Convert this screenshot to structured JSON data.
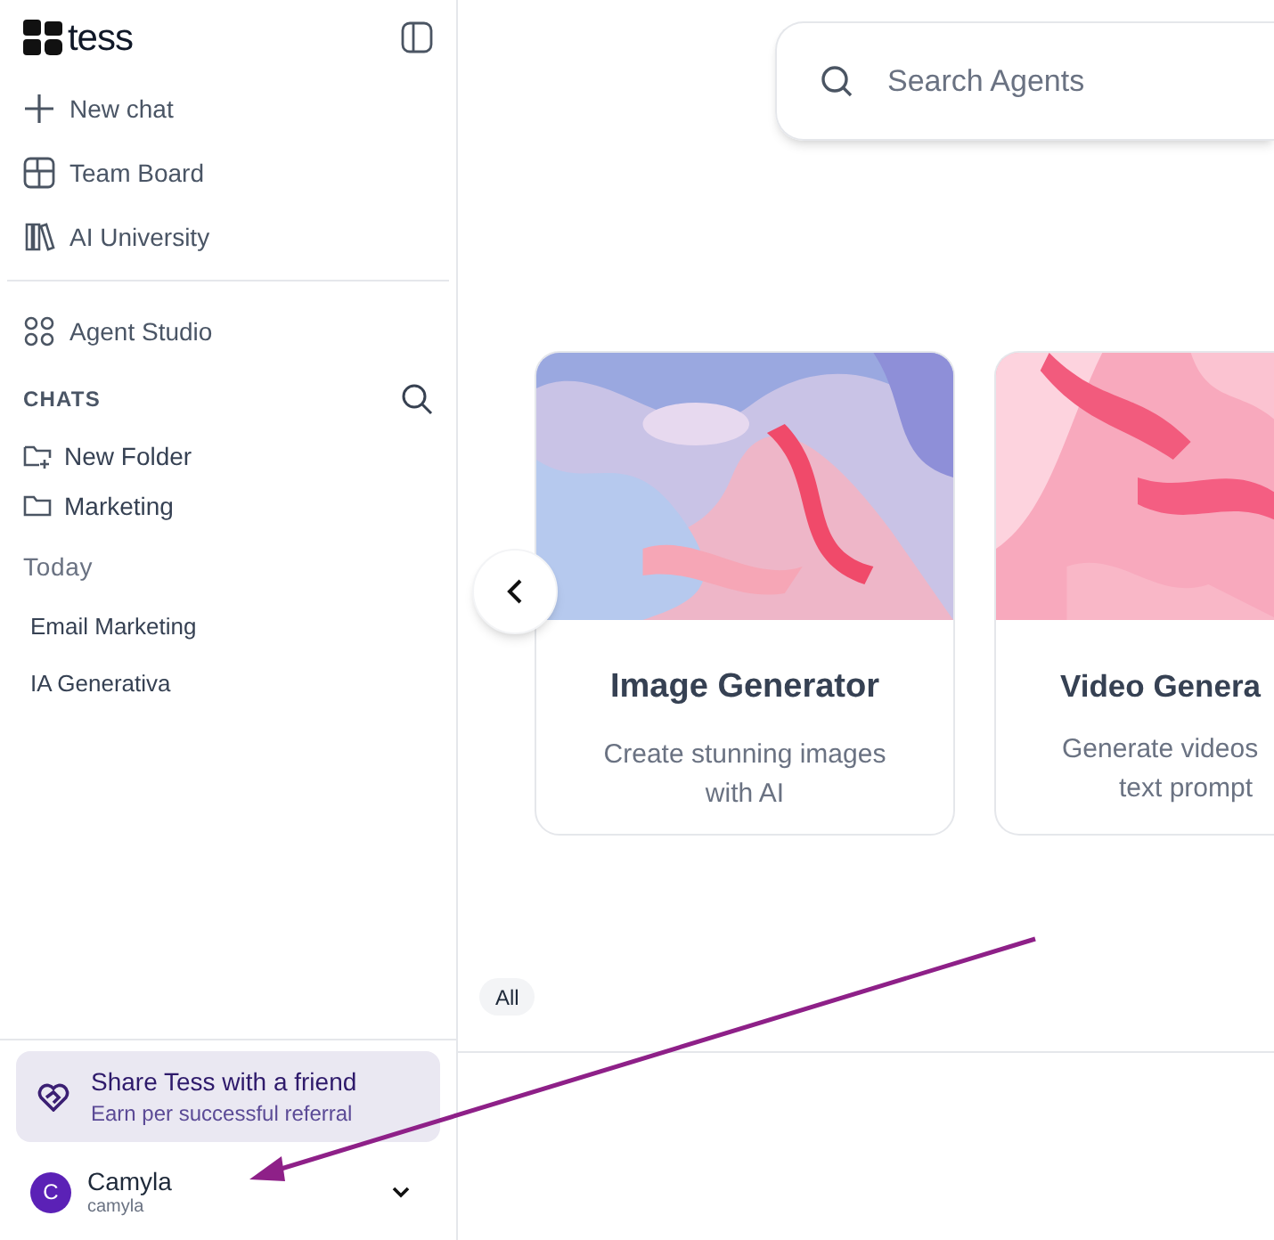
{
  "sidebar": {
    "logo": "tess",
    "nav": [
      {
        "kind": "plus",
        "label": "New chat"
      },
      {
        "kind": "board",
        "label": "Team Board"
      },
      {
        "kind": "books",
        "label": "AI University"
      }
    ],
    "studio": {
      "label": "Agent Studio"
    },
    "chats_heading": "CHATS",
    "folders": [
      {
        "kind": "new",
        "label": "New Folder"
      },
      {
        "kind": "folder",
        "label": "Marketing"
      }
    ],
    "today_heading": "Today",
    "conversations": [
      "Email Marketing",
      "IA Generativa"
    ],
    "share": {
      "title": "Share Tess with a friend",
      "subtitle": "Earn per successful referral"
    },
    "user": {
      "initial": "C",
      "name": "Camyla",
      "email": "camyla"
    }
  },
  "main": {
    "search": {
      "placeholder": "Search Agents"
    },
    "cards": [
      {
        "kind": "marble",
        "title": "Image Generator",
        "description": "Create stunning images with AI"
      },
      {
        "kind": "pink",
        "title": "Video Genera",
        "description_lines": [
          "Generate videos",
          "text prompt"
        ]
      }
    ],
    "filters": [
      {
        "label": "All",
        "selected": true
      }
    ]
  }
}
